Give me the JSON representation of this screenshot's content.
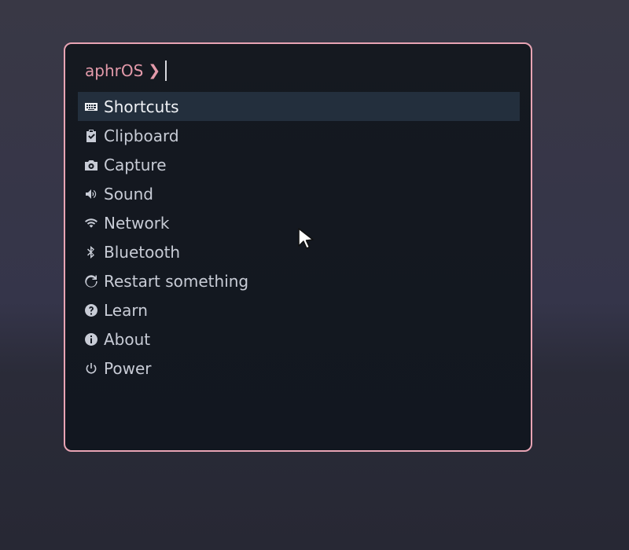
{
  "prompt": {
    "label": "aphrOS",
    "chevron": "❯",
    "value": ""
  },
  "menu": {
    "selected_index": 0,
    "items": [
      {
        "label": "Shortcuts",
        "icon": "keyboard-icon"
      },
      {
        "label": "Clipboard",
        "icon": "clipboard-check-icon"
      },
      {
        "label": "Capture",
        "icon": "camera-icon"
      },
      {
        "label": "Sound",
        "icon": "speaker-icon"
      },
      {
        "label": "Network",
        "icon": "wifi-icon"
      },
      {
        "label": "Bluetooth",
        "icon": "bluetooth-icon"
      },
      {
        "label": "Restart something",
        "icon": "refresh-icon"
      },
      {
        "label": "Learn",
        "icon": "help-circle-icon"
      },
      {
        "label": "About",
        "icon": "info-circle-icon"
      },
      {
        "label": "Power",
        "icon": "power-icon"
      }
    ]
  },
  "colors": {
    "accent": "#e8a4b4",
    "panel_bg": "#141920",
    "selected_bg": "#232f3d",
    "text": "#c8ccd6"
  }
}
